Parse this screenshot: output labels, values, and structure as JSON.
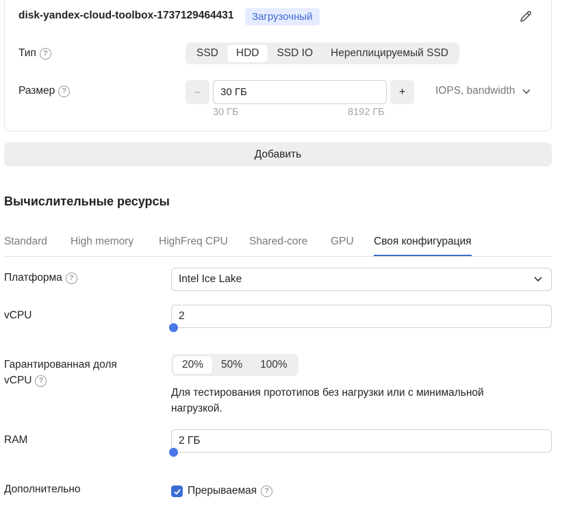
{
  "disk": {
    "name": "disk-yandex-cloud-toolbox-1737129464431",
    "badge": "Загрузочный",
    "type_label": "Тип",
    "type_options": [
      "SSD",
      "HDD",
      "SSD IO",
      "Нереплицируемый SSD"
    ],
    "type_selected": "HDD",
    "size_label": "Размер",
    "size_value": "30 ГБ",
    "size_min": "30 ГБ",
    "size_max": "8192 ГБ",
    "minus": "–",
    "plus": "+",
    "iops_label": "IOPS, bandwidth"
  },
  "add_button": "Добавить",
  "compute": {
    "title": "Вычислительные ресурсы",
    "tabs": [
      "Standard",
      "High memory",
      "HighFreq CPU",
      "Shared-core",
      "GPU",
      "Своя конфигурация"
    ],
    "active_tab": "Своя конфигурация",
    "platform_label": "Платформа",
    "platform_value": "Intel Ice Lake",
    "vcpu_label": "vCPU",
    "vcpu_value": "2",
    "share_label_line1": "Гарантированная доля",
    "share_label_line2": "vCPU",
    "share_options": [
      "20%",
      "50%",
      "100%"
    ],
    "share_selected": "20%",
    "share_desc": "Для тестирования прототипов без нагрузки или с минимальной нагрузкой.",
    "ram_label": "RAM",
    "ram_value": "2 ГБ",
    "extra_label": "Дополнительно",
    "preemptible_label": "Прерываемая",
    "preemptible_checked": true
  },
  "colors": {
    "accent": "#3e6cd6",
    "slider": "#4a77e8",
    "badge_bg": "#e5ecff"
  }
}
